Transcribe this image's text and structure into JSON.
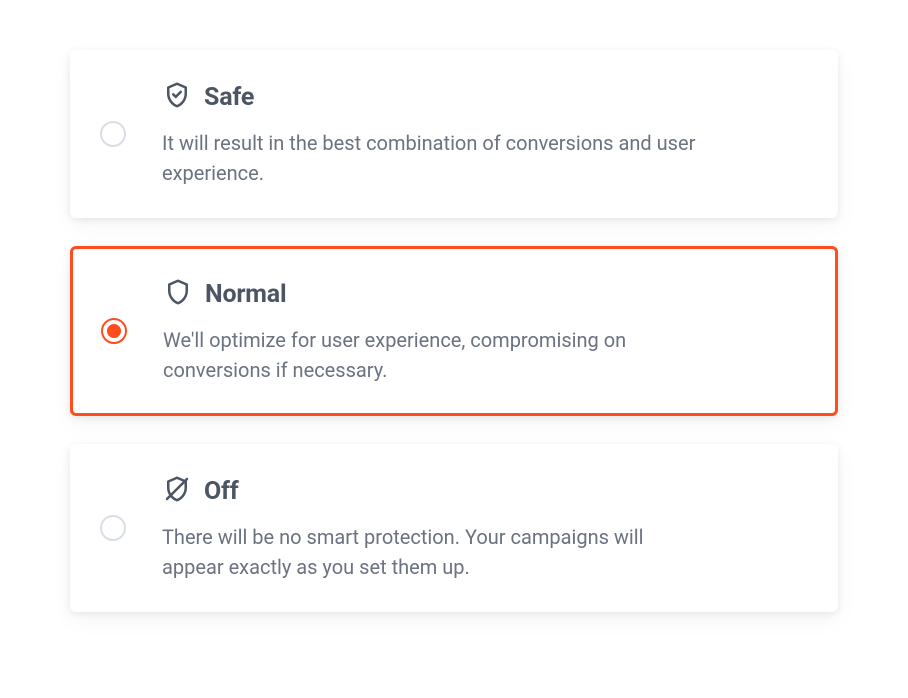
{
  "options": [
    {
      "id": "safe",
      "title": "Safe",
      "description": "It will result in the best combination of conversions and user experience."
    },
    {
      "id": "normal",
      "title": "Normal",
      "description": "We'll optimize for user experience, compromising on conversions if necessary."
    },
    {
      "id": "off",
      "title": "Off",
      "description": "There will be no smart protection. Your campaigns will appear exactly as you set them up."
    }
  ],
  "selected": "normal",
  "colors": {
    "accent": "#ff4d1f",
    "text_primary": "#4b5563",
    "text_secondary": "#6b7280",
    "border_idle": "#d9dee5"
  }
}
